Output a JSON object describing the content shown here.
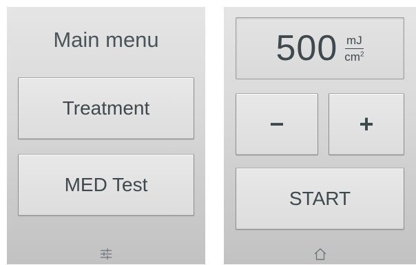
{
  "left_panel": {
    "title": "Main menu",
    "buttons": [
      {
        "label": "Treatment"
      },
      {
        "label": "MED Test"
      }
    ],
    "bottom_icon": "sliders-icon"
  },
  "right_panel": {
    "dose": {
      "value": "500",
      "unit_numerator": "mJ",
      "unit_denominator": "cm",
      "unit_exponent": "2"
    },
    "minus_label": "−",
    "plus_label": "+",
    "start_label": "START",
    "bottom_icon": "home-icon"
  },
  "colors": {
    "text": "#3e484d",
    "panel_top": "#e5e5e5",
    "panel_bottom": "#c2c2c2",
    "button_border": "#8b8f91"
  }
}
